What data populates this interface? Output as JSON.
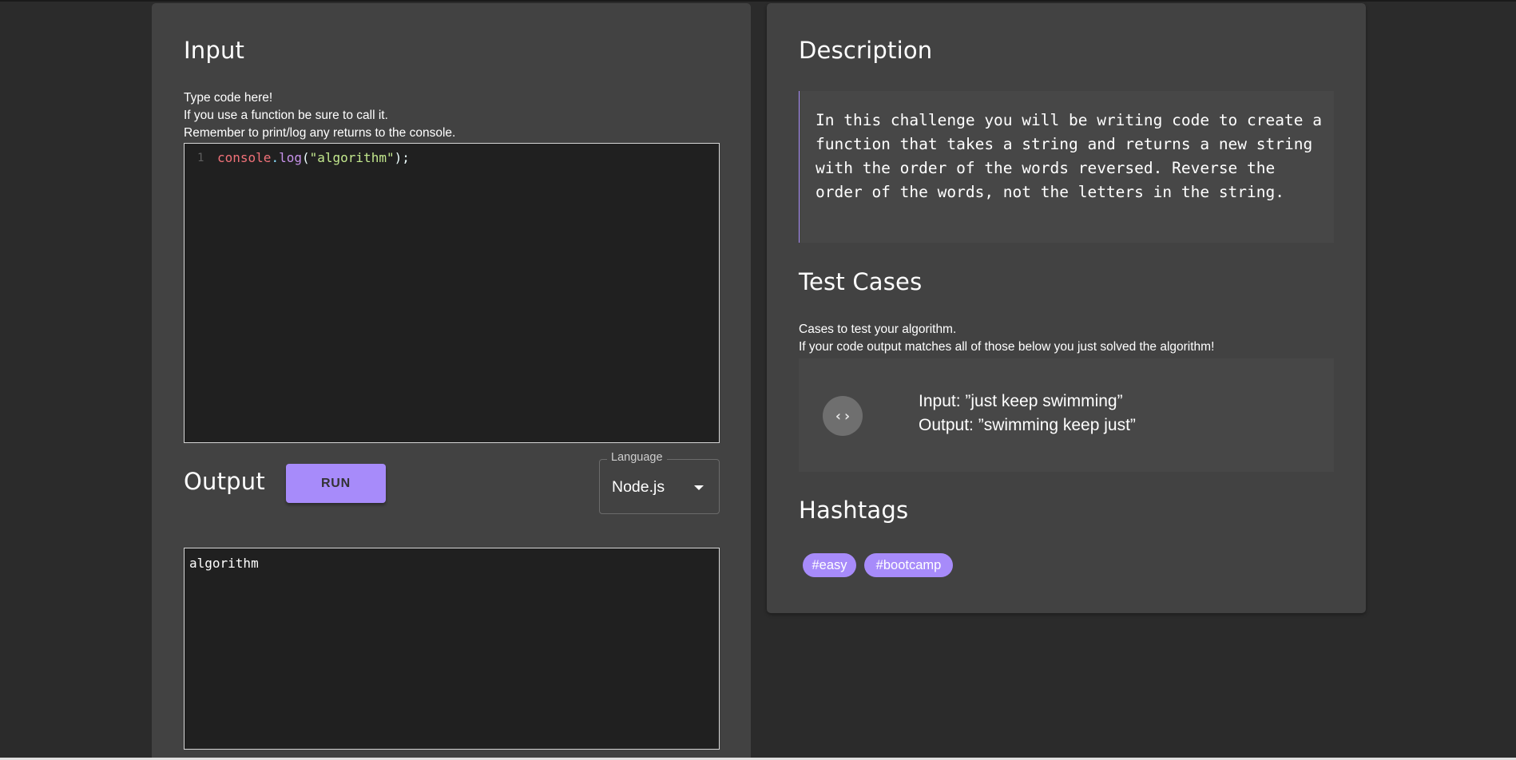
{
  "colors": {
    "background": "#2b2b2b",
    "panel": "#424242",
    "editor_background": "#202020",
    "accent": "#a78bfa"
  },
  "input": {
    "title": "Input",
    "instructions": [
      "Type code here!",
      "If you use a function be sure to call it.",
      "Remember to print/log any returns to the console."
    ],
    "editor": {
      "line_number": "1",
      "tokens": {
        "object": "console",
        "dot": ".",
        "method": "log",
        "open_paren": "(",
        "string": "\"algorithm\"",
        "close": ");"
      }
    }
  },
  "output": {
    "title": "Output",
    "run_label": "RUN",
    "language": {
      "label": "Language",
      "selected": "Node.js",
      "icon": "chevron-down-icon"
    },
    "console_text": "algorithm"
  },
  "description": {
    "title": "Description",
    "text": "In this challenge you will be writing code to create a function that takes a string and returns a new string with the order of the words reversed. Reverse the order of the words, not the letters in the string."
  },
  "test_cases": {
    "title": "Test Cases",
    "intro": [
      "Cases to test your algorithm.",
      "If your code output matches all of those below you just solved the algorithm!"
    ],
    "items": [
      {
        "icon": "code-icon",
        "input": "Input: ”just keep swimming”",
        "output": "Output: ”swimming keep just”"
      }
    ]
  },
  "hashtags": {
    "title": "Hashtags",
    "tags": [
      "#easy",
      "#bootcamp"
    ]
  }
}
